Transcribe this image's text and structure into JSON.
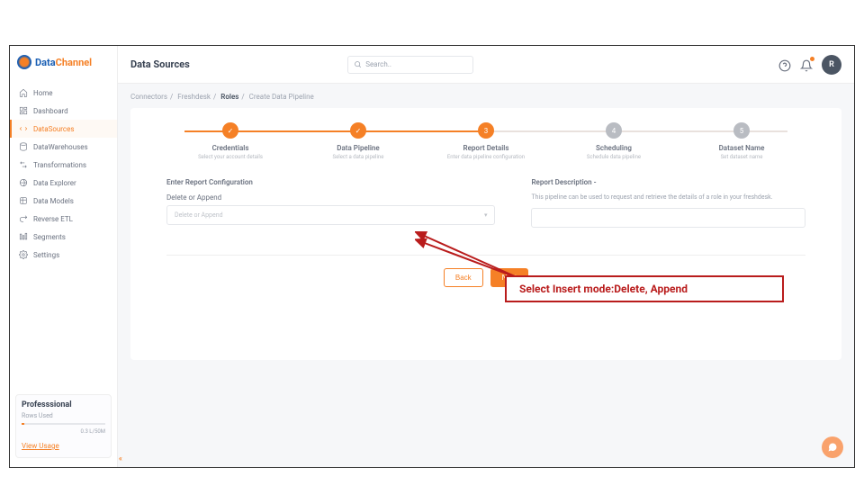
{
  "brand": {
    "part1": "Data",
    "part2": "Channel"
  },
  "sidebar": {
    "items": [
      {
        "label": "Home"
      },
      {
        "label": "Dashboard"
      },
      {
        "label": "DataSources"
      },
      {
        "label": "DataWarehouses"
      },
      {
        "label": "Transformations"
      },
      {
        "label": "Data Explorer"
      },
      {
        "label": "Data Models"
      },
      {
        "label": "Reverse ETL"
      },
      {
        "label": "Segments"
      },
      {
        "label": "Settings"
      }
    ],
    "plan": {
      "name": "Professsional",
      "rows_label": "Rows Used",
      "value": "0.3 L/50M",
      "link": "View Usage"
    }
  },
  "header": {
    "title": "Data Sources",
    "search_placeholder": "Search..",
    "avatar": "R"
  },
  "breadcrumb": [
    {
      "label": "Connectors"
    },
    {
      "label": "Freshdesk"
    },
    {
      "label": "Roles"
    },
    {
      "label": "Create Data Pipeline"
    }
  ],
  "stepper": [
    {
      "title": "Credentials",
      "sub": "Select your account details",
      "state": "done",
      "glyph": "✓"
    },
    {
      "title": "Data Pipeline",
      "sub": "Select a data pipeline",
      "state": "done",
      "glyph": "✓"
    },
    {
      "title": "Report Details",
      "sub": "Enter data pipeline configuration",
      "state": "active",
      "glyph": "3"
    },
    {
      "title": "Scheduling",
      "sub": "Schedule data pipeline",
      "state": "future",
      "glyph": "4"
    },
    {
      "title": "Dataset Name",
      "sub": "Set dataset name",
      "state": "future",
      "glyph": "5"
    }
  ],
  "form": {
    "section_label": "Enter Report Configuration",
    "field_label": "Delete or Append",
    "select_placeholder": "Delete or Append",
    "desc_label": "Report Description -",
    "desc_text": "This pipeline can be used to request and retrieve the details of a role in your freshdesk."
  },
  "buttons": {
    "back": "Back",
    "next": "Next"
  },
  "annotation": "Select Insert mode:Delete, Append"
}
